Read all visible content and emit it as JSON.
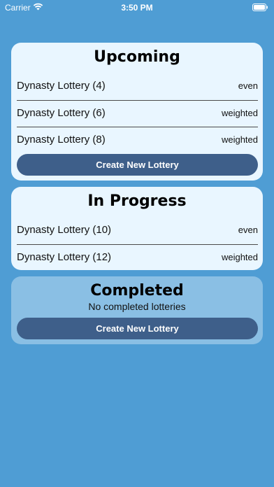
{
  "status_bar": {
    "carrier": "Carrier",
    "time": "3:50 PM"
  },
  "upcoming": {
    "title": "Upcoming",
    "rows": [
      {
        "name": "Dynasty Lottery (4)",
        "kind": "even"
      },
      {
        "name": "Dynasty Lottery (6)",
        "kind": "weighted"
      },
      {
        "name": "Dynasty Lottery (8)",
        "kind": "weighted"
      }
    ],
    "button_label": "Create New Lottery"
  },
  "in_progress": {
    "title": "In Progress",
    "rows": [
      {
        "name": "Dynasty Lottery (10)",
        "kind": "even"
      },
      {
        "name": "Dynasty Lottery (12)",
        "kind": "weighted"
      }
    ]
  },
  "completed": {
    "title": "Completed",
    "empty_message": "No completed lotteries",
    "button_label": "Create New Lottery"
  },
  "colors": {
    "background": "#4f9dd4",
    "card": "#e9f6ff",
    "button": "#3e5f8a"
  }
}
